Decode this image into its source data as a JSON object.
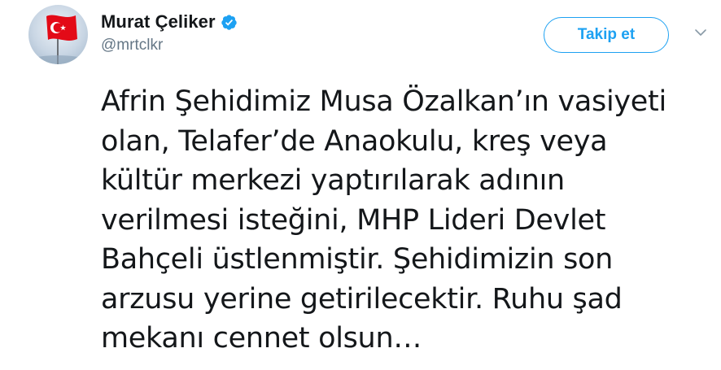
{
  "author": {
    "display_name": "Murat Çeliker",
    "handle": "@mrtclkr",
    "verified": true,
    "avatar_icon": "turkish-flag-avatar"
  },
  "actions": {
    "follow_label": "Takip et",
    "menu_icon": "chevron-down-icon"
  },
  "tweet": {
    "text": "Afrin Şehidimiz Musa Özalkan’ın vasiyeti\nolan, Telafer’de Anaokulu, kreş veya\nkültür merkezi yaptırılarak adının\nverilmesi isteğini, MHP Lideri Devlet\nBahçeli üstlenmiştir. Şehidimizin son\narzusu yerine getirilecektir. Ruhu şad\nmekanı cennet olsun…"
  },
  "colors": {
    "accent": "#1da1f2",
    "text": "#14171a",
    "secondary_text": "#657786",
    "flag_red": "#e30a17"
  }
}
